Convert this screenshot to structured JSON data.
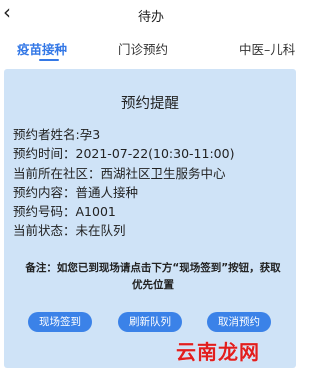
{
  "header": {
    "back_icon": "chevron-left-icon",
    "back_glyph": "‹",
    "title": "待办"
  },
  "tabs": [
    {
      "label": "疫苗接种",
      "active": true
    },
    {
      "label": "门诊预约",
      "active": false
    },
    {
      "label": "中医–儿科",
      "active": false
    }
  ],
  "card": {
    "title": "预约提醒",
    "rows": [
      "预约者姓名:孕3",
      "预约时间：2021-07-22(10:30-11:00)",
      "当前所在社区：西湖社区卫生服务中心",
      "预约内容：普通人接种",
      "预约号码：A1001",
      "当前状态：未在队列"
    ],
    "note": "备注：如您已到现场请点击下方“现场签到”按钮，获取优先位置",
    "buttons": {
      "checkin": "现场签到",
      "refresh": "刷新队列",
      "cancel": "取消预约"
    }
  },
  "watermark": "云南龙网",
  "colors": {
    "accent": "#3478e6",
    "card_bg": "#cfe3f7",
    "button_bg": "#3b82e8",
    "watermark": "#e11e1e"
  }
}
